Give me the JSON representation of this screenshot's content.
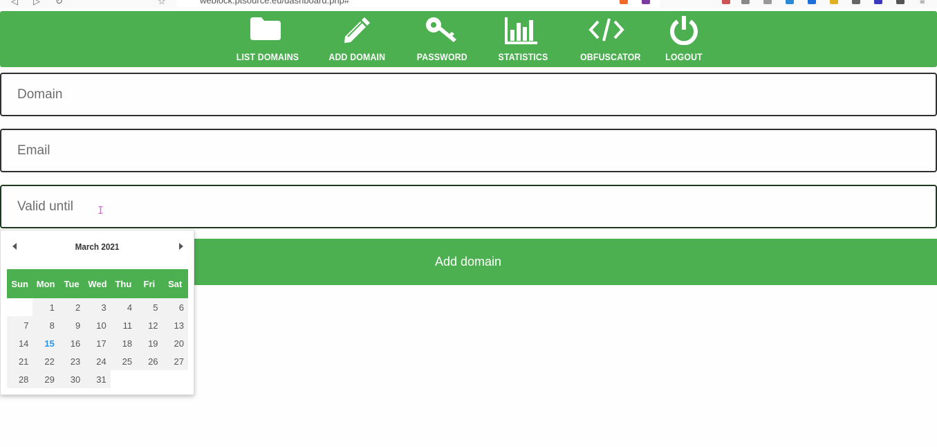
{
  "browser": {
    "url": "weblock.ptsource.eu/dashboard.php#"
  },
  "nav": {
    "items": [
      {
        "label": "LIST DOMAINS",
        "icon": "folder-icon"
      },
      {
        "label": "ADD DOMAIN",
        "icon": "pencil-icon"
      },
      {
        "label": "PASSWORD",
        "icon": "key-icon"
      },
      {
        "label": "STATISTICS",
        "icon": "bar-chart-icon"
      },
      {
        "label": "OBFUSCATOR",
        "icon": "code-icon"
      },
      {
        "label": "LOGOUT",
        "icon": "power-icon"
      }
    ]
  },
  "form": {
    "domain_placeholder": "Domain",
    "email_placeholder": "Email",
    "valid_until_placeholder": "Valid until",
    "submit_label": "Add domain"
  },
  "datepicker": {
    "title": "March  2021",
    "weekdays": [
      "Sun",
      "Mon",
      "Tue",
      "Wed",
      "Thu",
      "Fri",
      "Sat"
    ],
    "weeks": [
      [
        "",
        "1",
        "2",
        "3",
        "4",
        "5",
        "6"
      ],
      [
        "7",
        "8",
        "9",
        "10",
        "11",
        "12",
        "13"
      ],
      [
        "14",
        "15",
        "16",
        "17",
        "18",
        "19",
        "20"
      ],
      [
        "21",
        "22",
        "23",
        "24",
        "25",
        "26",
        "27"
      ],
      [
        "28",
        "29",
        "30",
        "31",
        "",
        "",
        ""
      ]
    ],
    "today": "15"
  },
  "colors": {
    "brand_green": "#4caf50",
    "today_blue": "#2196f3"
  }
}
